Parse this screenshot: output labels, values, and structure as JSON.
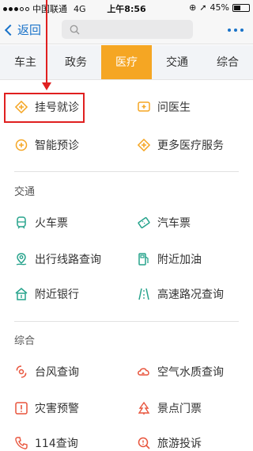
{
  "status_bar": {
    "carrier": "中国联通",
    "network": "4G",
    "time": "上午8:56",
    "battery": "45%",
    "battery_level": 0.45
  },
  "nav": {
    "back_label": "返回",
    "search_placeholder": ""
  },
  "tabs": [
    {
      "label": "车主",
      "active": false
    },
    {
      "label": "政务",
      "active": false
    },
    {
      "label": "医疗",
      "active": true
    },
    {
      "label": "交通",
      "active": false
    },
    {
      "label": "综合",
      "active": false
    }
  ],
  "medical": {
    "items": [
      {
        "label": "挂号就诊",
        "icon": "diamond-plus-icon"
      },
      {
        "label": "问医生",
        "icon": "chat-plus-icon"
      },
      {
        "label": "智能预诊",
        "icon": "circle-plus-icon"
      },
      {
        "label": "更多医疗服务",
        "icon": "diamond-plus-icon"
      }
    ]
  },
  "traffic": {
    "title": "交通",
    "items": [
      {
        "label": "火车票",
        "icon": "train-icon"
      },
      {
        "label": "汽车票",
        "icon": "bus-ticket-icon"
      },
      {
        "label": "出行线路查询",
        "icon": "route-icon"
      },
      {
        "label": "附近加油",
        "icon": "fuel-icon"
      },
      {
        "label": "附近银行",
        "icon": "bank-icon"
      },
      {
        "label": "高速路况查询",
        "icon": "road-icon"
      }
    ]
  },
  "general": {
    "title": "综合",
    "items": [
      {
        "label": "台风查询",
        "icon": "typhoon-icon"
      },
      {
        "label": "空气水质查询",
        "icon": "air-quality-icon"
      },
      {
        "label": "灾害预警",
        "icon": "warning-icon"
      },
      {
        "label": "景点门票",
        "icon": "scenic-icon"
      },
      {
        "label": "114查询",
        "icon": "phone-icon"
      },
      {
        "label": "旅游投诉",
        "icon": "complaint-icon"
      }
    ]
  },
  "colors": {
    "accent_orange": "#f5a623",
    "traffic_green": "#26a38c",
    "general_red": "#e8543c",
    "link_blue": "#1a73c9",
    "annotation_red": "#e02020"
  }
}
